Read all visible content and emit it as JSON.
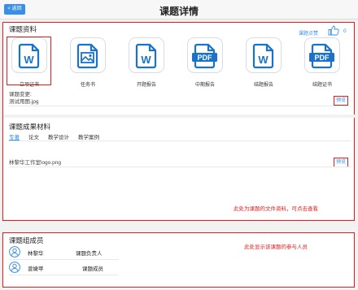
{
  "header": {
    "back_label": "< 返回",
    "title": "课题详情"
  },
  "materials": {
    "title": "课题资料",
    "like_label": "课题点赞",
    "like_count": "0",
    "documents": [
      {
        "label": "立项证书",
        "icon": "word-doc-icon"
      },
      {
        "label": "任务书",
        "icon": "image-doc-icon"
      },
      {
        "label": "开题报告",
        "icon": "word-doc-icon"
      },
      {
        "label": "中期报告",
        "icon": "pdf-doc-icon"
      },
      {
        "label": "结题报告",
        "icon": "word-doc-icon"
      },
      {
        "label": "结题证书",
        "icon": "pdf-doc-icon"
      }
    ],
    "change_label": "课题变更:",
    "change_file": "测试用图.jpg",
    "preview_label": "预览"
  },
  "results": {
    "title": "课题成果材料",
    "tabs": [
      "专著",
      "论文",
      "教学设计",
      "教学案例"
    ],
    "active_tab": "专著",
    "file": "林黎华工作室logo.png",
    "preview_label": "预览",
    "note": "此处为课题的文件资料，可点击查看"
  },
  "members": {
    "title": "课题组成员",
    "note": "此处显示该课题的参与人员",
    "list": [
      {
        "name": "林黎华",
        "role": "课题负责人"
      },
      {
        "name": "曾婕苹",
        "role": "课题成员"
      }
    ]
  },
  "colors": {
    "accent": "#3a8ee6",
    "annotation": "#e02020"
  }
}
